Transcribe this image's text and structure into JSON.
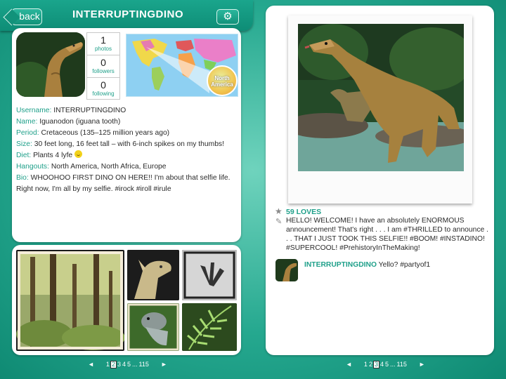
{
  "header": {
    "back_label": "back",
    "title": "INTERRUPTINGDINO",
    "settings_icon": "gear-icon"
  },
  "profile": {
    "stats": [
      {
        "num": "1",
        "label": "photos"
      },
      {
        "num": "0",
        "label": "followers"
      },
      {
        "num": "0",
        "label": "following"
      }
    ],
    "map_badge": "North America",
    "fields": {
      "username_label": "Username:",
      "username": "INTERRUPTINGDINO",
      "name_label": "Name:",
      "name": "Iguanodon (iguana tooth)",
      "period_label": "Period:",
      "period": "Cretaceous (135–125 million years ago)",
      "size_label": "Size:",
      "size": "30 feet long, 16 feet tall – with 6-inch spikes on my thumbs!",
      "diet_label": "Diet:",
      "diet": "Plants 4 lyfe",
      "hangouts_label": "Hangouts:",
      "hangouts": "North America, North Africa, Europe",
      "bio_label": "Bio:",
      "bio": "WHOOHOO FIRST DINO ON HERE!! I'm about that selfie life. Right now, I'm all by my selfie. #irock #iroll #irule"
    }
  },
  "post": {
    "loves": "59 LOVES",
    "caption": "HELLO! WELCOME! I have an absolutely ENORMOUS announcement! That's right . . . I am #THRILLED to announce . . . THAT I JUST TOOK THIS SELFIE!! #BOOM! #INSTADINO! #SUPERCOOL! #PrehistoryInTheMaking!",
    "comment": {
      "user": "INTERRUPTINGDINO",
      "text": "Yello? #partyof1"
    }
  },
  "pager_left": {
    "prev": "◄",
    "pages": [
      "1",
      "2",
      "3",
      "4",
      "5",
      "...",
      "115"
    ],
    "current": "2",
    "next": "►"
  },
  "pager_right": {
    "prev": "◄",
    "pages": [
      "1",
      "2",
      "3",
      "4",
      "5",
      "...",
      "115"
    ],
    "current": "3",
    "next": "►"
  },
  "colors": {
    "accent": "#1fa08a",
    "header": "#12927a"
  }
}
